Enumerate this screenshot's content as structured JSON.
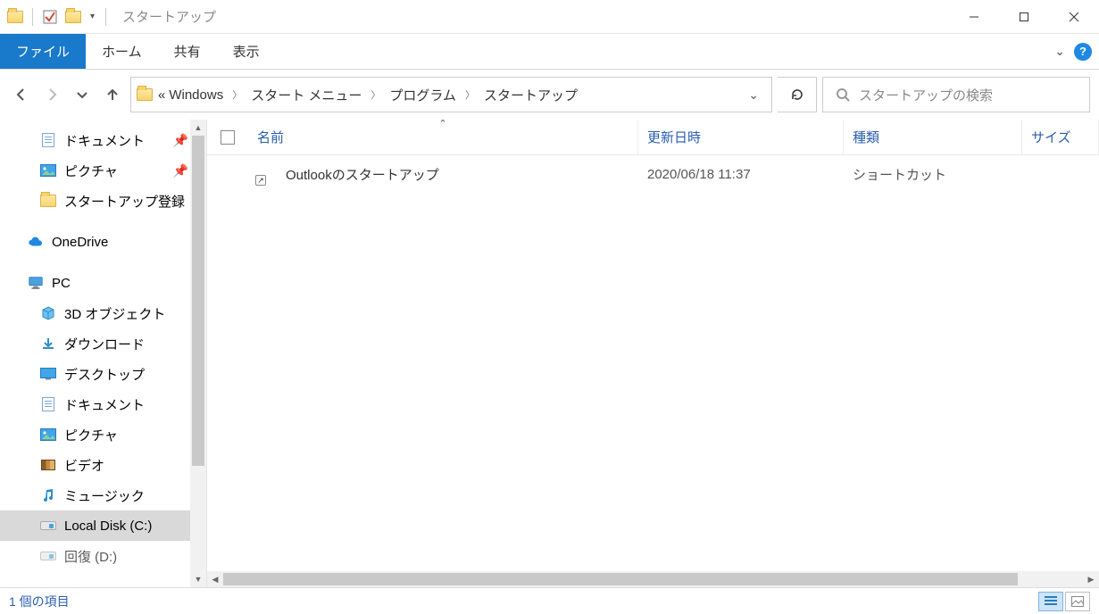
{
  "title": "スタートアップ",
  "ribbon": {
    "file": "ファイル",
    "home": "ホーム",
    "share": "共有",
    "view": "表示"
  },
  "breadcrumbs": {
    "prefix": "«",
    "items": [
      "Windows",
      "スタート メニュー",
      "プログラム",
      "スタートアップ"
    ]
  },
  "search": {
    "placeholder": "スタートアップの検索"
  },
  "nav": {
    "documents": "ドキュメント",
    "pictures": "ピクチャ",
    "startup_reg": "スタートアップ登録",
    "onedrive": "OneDrive",
    "pc": "PC",
    "objects3d": "3D オブジェクト",
    "downloads": "ダウンロード",
    "desktop": "デスクトップ",
    "documents2": "ドキュメント",
    "pictures2": "ピクチャ",
    "videos": "ビデオ",
    "music": "ミュージック",
    "local_c": "Local Disk (C:)",
    "recovery_d": "回復 (D:)"
  },
  "columns": {
    "name": "名前",
    "date": "更新日時",
    "type": "種類",
    "size": "サイズ"
  },
  "rows": [
    {
      "name": "Outlookのスタートアップ",
      "date": "2020/06/18 11:37",
      "type": "ショートカット",
      "size": ""
    }
  ],
  "status": "1 個の項目"
}
